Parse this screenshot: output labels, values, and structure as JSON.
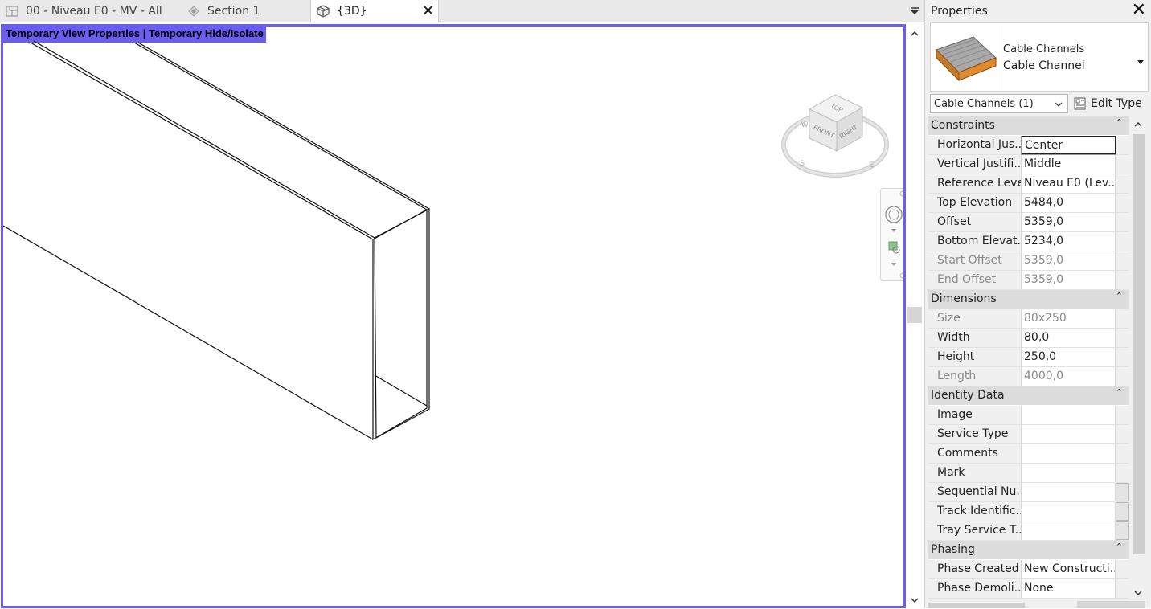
{
  "tabs": [
    {
      "label": "00 - Niveau E0 - MV - All",
      "icon": "floor-plan-icon"
    },
    {
      "label": "Section 1",
      "icon": "section-icon"
    },
    {
      "label": "{3D}",
      "icon": "3d-view-icon",
      "active": true
    }
  ],
  "view": {
    "banner": "Temporary View Properties | Temporary Hide/Isolate",
    "banner_color": "#6a5ef0",
    "viewcube": {
      "top": "TOP",
      "front": "FRONT",
      "right": "RIGHT"
    }
  },
  "properties": {
    "title": "Properties",
    "type_family": "Cable Channels",
    "type_name": "Cable Channel",
    "instance_filter": "Cable Channels (1)",
    "edit_type": "Edit Type",
    "groups": [
      {
        "name": "Constraints",
        "rows": [
          {
            "label": "Horizontal Jus...",
            "value": "Center",
            "selected": true
          },
          {
            "label": "Vertical Justifi...",
            "value": "Middle"
          },
          {
            "label": "Reference Level",
            "value": "Niveau E0 (Lev..."
          },
          {
            "label": "Top Elevation",
            "value": "5484,0"
          },
          {
            "label": "Offset",
            "value": "5359,0"
          },
          {
            "label": "Bottom Elevat...",
            "value": "5234,0"
          },
          {
            "label": "Start Offset",
            "value": "5359,0",
            "readonly": true
          },
          {
            "label": "End Offset",
            "value": "5359,0",
            "readonly": true
          }
        ]
      },
      {
        "name": "Dimensions",
        "rows": [
          {
            "label": "Size",
            "value": "80x250",
            "readonly": true
          },
          {
            "label": "Width",
            "value": "80,0"
          },
          {
            "label": "Height",
            "value": "250,0"
          },
          {
            "label": "Length",
            "value": "4000,0",
            "readonly": true
          }
        ]
      },
      {
        "name": "Identity Data",
        "rows": [
          {
            "label": "Image",
            "value": ""
          },
          {
            "label": "Service Type",
            "value": ""
          },
          {
            "label": "Comments",
            "value": ""
          },
          {
            "label": "Mark",
            "value": ""
          },
          {
            "label": "Sequential Nu...",
            "value": "",
            "button": true
          },
          {
            "label": "Track Identific...",
            "value": "",
            "button": true
          },
          {
            "label": "Tray Service T...",
            "value": "",
            "button": true
          }
        ]
      },
      {
        "name": "Phasing",
        "rows": [
          {
            "label": "Phase Created",
            "value": "New Constructi..."
          },
          {
            "label": "Phase Demoli...",
            "value": "None"
          }
        ]
      }
    ]
  }
}
